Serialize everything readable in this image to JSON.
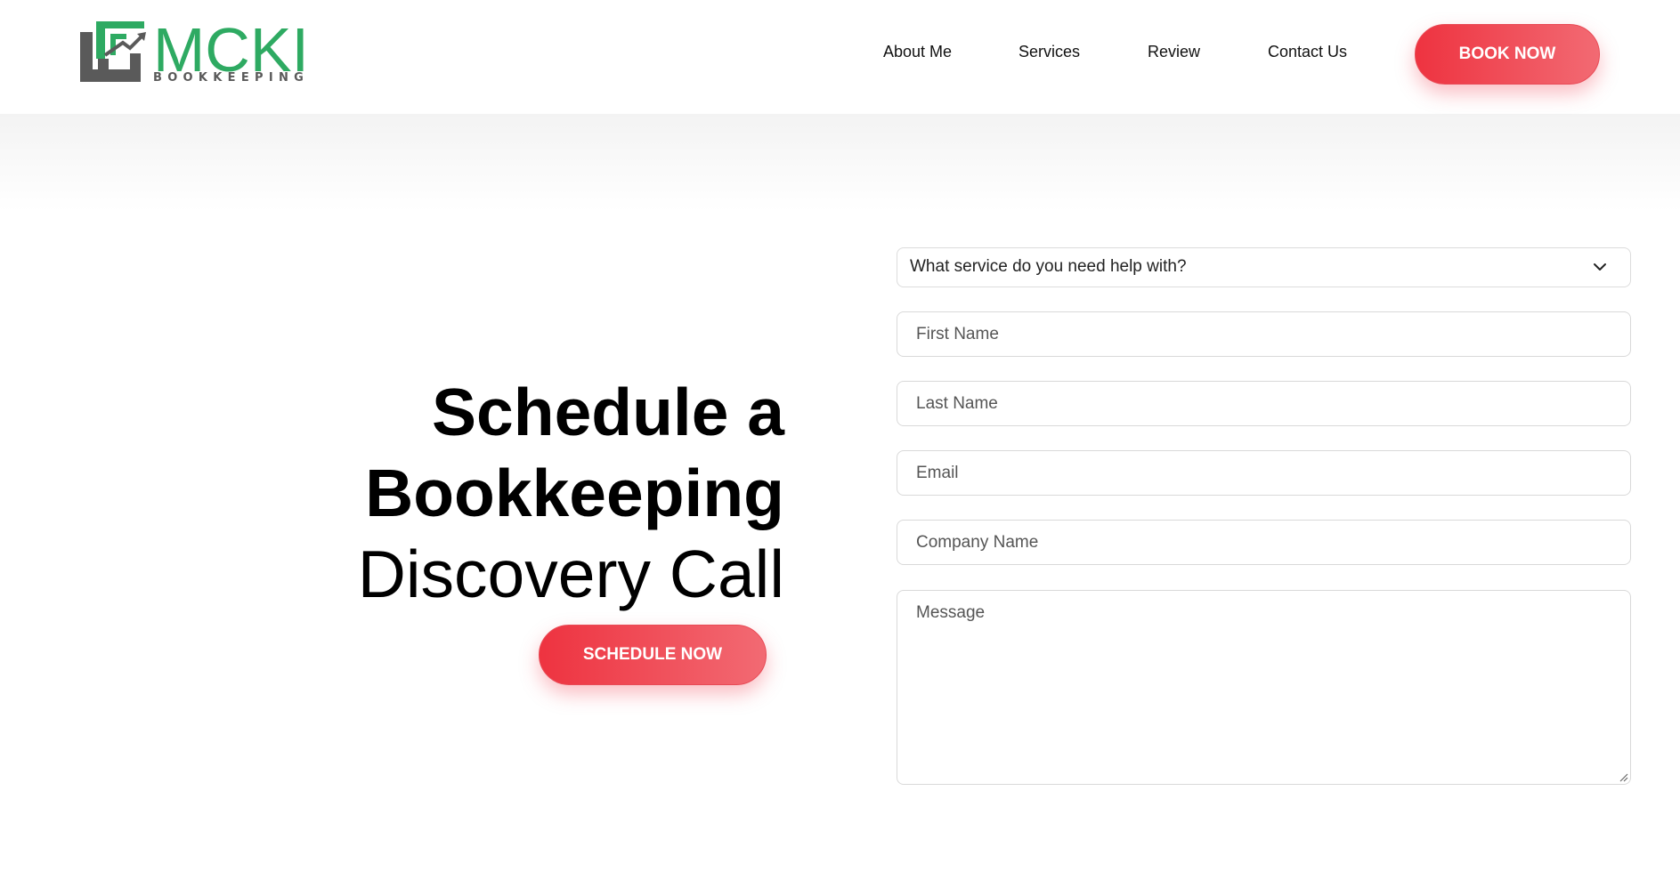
{
  "brand": {
    "name": "MCKI",
    "tagline": "BOOKKEEPING",
    "green": "#2eaa62",
    "gray": "#5a5a5a"
  },
  "nav": {
    "items": [
      "About Me",
      "Services",
      "Review",
      "Contact Us"
    ],
    "book_label": "BOOK NOW"
  },
  "hero": {
    "line1": "Schedule a",
    "line2": "Bookkeeping",
    "line3": "Discovery Call",
    "cta_label": "SCHEDULE NOW",
    "accent": "#ee3340"
  },
  "form": {
    "service_select": "What service do you need help with?",
    "first_name_placeholder": "First Name",
    "last_name_placeholder": "Last Name",
    "email_placeholder": "Email",
    "company_placeholder": "Company Name",
    "message_placeholder": "Message"
  },
  "icons": {
    "select_arrow": "chevron-down-icon",
    "textarea_resize": "resize-handle-icon"
  }
}
